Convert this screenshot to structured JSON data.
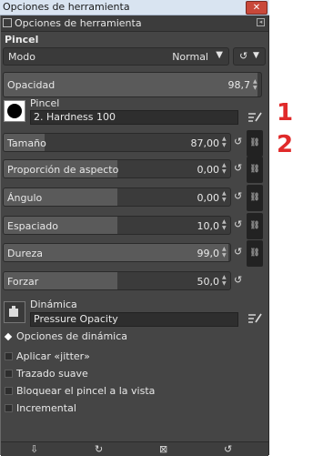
{
  "window": {
    "title": "Opciones de herramienta",
    "close_glyph": "✕"
  },
  "dock": {
    "tab_label": "Opciones de herramienta",
    "menu_glyph": "◂"
  },
  "section_title": "Pincel",
  "mode": {
    "label": "Modo",
    "value": "Normal"
  },
  "opacity": {
    "label": "Opacidad",
    "value": "98,7",
    "fraction": 0.987
  },
  "brush": {
    "label": "Pincel",
    "name": "2. Hardness 100"
  },
  "sliders": [
    {
      "label": "Tamaño",
      "value": "87,00",
      "fraction": 0.18
    },
    {
      "label": "Proporción de aspecto",
      "value": "0,00",
      "fraction": 0.5
    },
    {
      "label": "Ángulo",
      "value": "0,00",
      "fraction": 0.5
    },
    {
      "label": "Espaciado",
      "value": "10,0",
      "fraction": 0.5
    },
    {
      "label": "Dureza",
      "value": "99,0",
      "fraction": 0.99
    },
    {
      "label": "Forzar",
      "value": "50,0",
      "fraction": 0.5
    }
  ],
  "dynamics": {
    "label": "Dinámica",
    "name": "Pressure Opacity"
  },
  "dynamics_options_label": "Opciones de dinámica",
  "checkboxes": [
    {
      "label": "Aplicar «jitter»",
      "checked": false
    },
    {
      "label": "Trazado suave",
      "checked": false
    },
    {
      "label": "Bloquear el pincel a la vista",
      "checked": false
    },
    {
      "label": "Incremental",
      "checked": false
    }
  ],
  "annotations": [
    "1",
    "2"
  ],
  "icons": {
    "reset": "↺",
    "chain": "⛓",
    "bottom": [
      "save-icon",
      "restore-icon",
      "delete-icon",
      "reset-icon"
    ]
  },
  "colors": {
    "annotation": "#e02a2a",
    "panel": "#454545",
    "slider_fill": "#5a5a5a"
  }
}
